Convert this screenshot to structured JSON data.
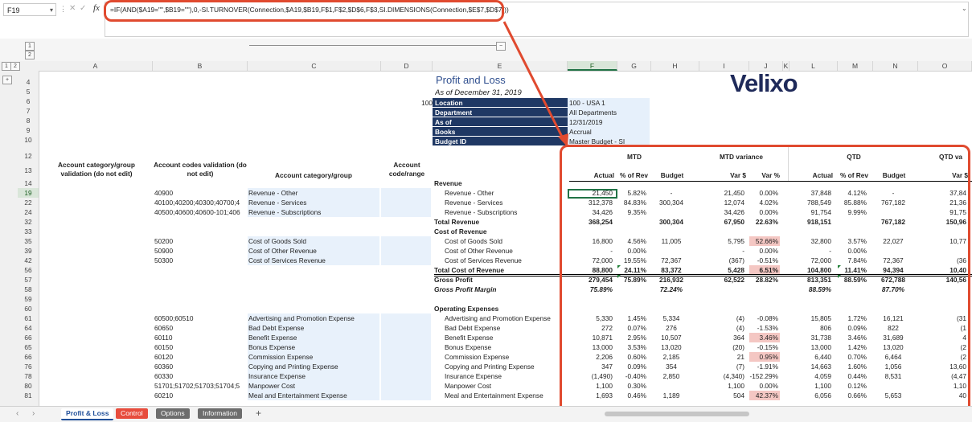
{
  "formula_bar": {
    "cell_ref": "F19",
    "formula": "=IF(AND($A19=\"\",$B19=\"\"),0,-SI.TURNOVER(Connection,$A19,$B19,F$1,F$2,$D$6,F$3,SI.DIMENSIONS(Connection,$E$7,$D$7)))",
    "dots": "⋮",
    "cancel_icon": "✕",
    "enter_icon": "✓",
    "fx_label": "fx"
  },
  "grouping": {
    "levels": [
      "1",
      "2"
    ],
    "outline": [
      "1",
      "2"
    ],
    "collapse": "−",
    "expand": "+"
  },
  "columns": [
    "A",
    "B",
    "C",
    "D",
    "E",
    "F",
    "G",
    "H",
    "I",
    "J",
    "K",
    "L",
    "M",
    "N",
    "O"
  ],
  "rows": [
    "4",
    "5",
    "6",
    "7",
    "8",
    "9",
    "10",
    "12",
    "13",
    "14",
    "19",
    "22",
    "24",
    "32",
    "33",
    "35",
    "39",
    "42",
    "56",
    "57",
    "58",
    "59",
    "60",
    "61",
    "64",
    "66",
    "65",
    "66",
    "76",
    "78",
    "80",
    "81"
  ],
  "report": {
    "title": "Profit and Loss",
    "subtitle": "As of December 31, 2019",
    "d6_value": "100",
    "params": [
      {
        "label": "Location",
        "value": "100 - USA 1"
      },
      {
        "label": "Department",
        "value": "All Departments"
      },
      {
        "label": "As of",
        "value": "12/31/2019"
      },
      {
        "label": "Books",
        "value": "Accrual"
      },
      {
        "label": "Budget ID",
        "value": "Master Budget - SI"
      }
    ],
    "logo": "Velixo"
  },
  "headers": {
    "col_a": "Account category/group validation (do not edit)",
    "col_b": "Account codes validation (do not edit)",
    "col_c": "Account category/group",
    "col_d": "Account code/range",
    "mtd": "MTD",
    "mtd_variance": "MTD variance",
    "qtd": "QTD",
    "qtd_variance": "QTD va",
    "sub": [
      "Actual",
      "% of Rev",
      "Budget",
      "Var $",
      "Var %",
      "Actual",
      "% of Rev",
      "Budget",
      "Var $"
    ]
  },
  "lines": [
    {
      "a": "",
      "b": "",
      "c": "",
      "e": "Revenue",
      "eb": true,
      "v": [
        "",
        "",
        "",
        "",
        "",
        "",
        "",
        "",
        ""
      ]
    },
    {
      "a": "",
      "b": "40900",
      "c": "Revenue - Other",
      "e": "Revenue - Other",
      "ind": true,
      "v": [
        "21,450",
        "5.82%",
        "-",
        "21,450",
        "0.00%",
        "37,848",
        "4.12%",
        "-",
        "37,84"
      ]
    },
    {
      "a": "",
      "b": "40100;40200;40300;40700;4",
      "c": "Revenue - Services",
      "e": "Revenue - Services",
      "ind": true,
      "v": [
        "312,378",
        "84.83%",
        "300,304",
        "12,074",
        "4.02%",
        "788,549",
        "85.88%",
        "767,182",
        "21,36"
      ]
    },
    {
      "a": "",
      "b": "40500;40600;40600-101;406",
      "c": "Revenue - Subscriptions",
      "e": "Revenue - Subscriptions",
      "ind": true,
      "v": [
        "34,426",
        "9.35%",
        "",
        "34,426",
        "0.00%",
        "91,754",
        "9.99%",
        "",
        "91,75"
      ]
    },
    {
      "a": "",
      "b": "",
      "c": "",
      "e": "Total Revenue",
      "eb": true,
      "vb": true,
      "v": [
        "368,254",
        "",
        "300,304",
        "67,950",
        "22.63%",
        "918,151",
        "",
        "767,182",
        "150,96"
      ]
    },
    {
      "a": "",
      "b": "",
      "c": "",
      "e": "Cost of Revenue",
      "eb": true,
      "v": [
        "",
        "",
        "",
        "",
        "",
        "",
        "",
        "",
        ""
      ]
    },
    {
      "a": "",
      "b": "50200",
      "c": "Cost of Goods Sold",
      "e": "Cost of Goods Sold",
      "ind": true,
      "v": [
        "16,800",
        "4.56%",
        "11,005",
        "5,795",
        "52.66%",
        "32,800",
        "3.57%",
        "22,027",
        "10,77"
      ],
      "neg": [
        4
      ]
    },
    {
      "a": "",
      "b": "50900",
      "c": "Cost of Other Revenue",
      "e": "Cost of Other Revenue",
      "ind": true,
      "v": [
        "-",
        "0.00%",
        "",
        "-",
        "0.00%",
        "-",
        "0.00%",
        "",
        ""
      ]
    },
    {
      "a": "",
      "b": "50300",
      "c": "Cost of Services Revenue",
      "e": "Cost of Services Revenue",
      "ind": true,
      "v": [
        "72,000",
        "19.55%",
        "72,367",
        "(367)",
        "-0.51%",
        "72,000",
        "7.84%",
        "72,367",
        "(36"
      ]
    },
    {
      "a": "",
      "b": "",
      "c": "",
      "e": "Total Cost of Revenue",
      "eb": true,
      "vb": true,
      "v": [
        "88,800",
        "24.11%",
        "83,372",
        "5,428",
        "6.51%",
        "104,800",
        "11.41%",
        "94,394",
        "10,40"
      ],
      "neg": [
        4
      ]
    },
    {
      "a": "",
      "b": "",
      "c": "",
      "e": "Gross Profit",
      "eb": true,
      "vb": true,
      "v": [
        "279,454",
        "75.89%",
        "216,932",
        "62,522",
        "28.82%",
        "813,351",
        "88.59%",
        "672,788",
        "140,56"
      ]
    },
    {
      "a": "",
      "b": "",
      "c": "",
      "e": "Gross Profit Margin",
      "eb": true,
      "ei": true,
      "vb": true,
      "vi": true,
      "v": [
        "75.89%",
        "",
        "72.24%",
        "",
        "",
        "88.59%",
        "",
        "87.70%",
        ""
      ]
    },
    {
      "a": "",
      "b": "",
      "c": "",
      "e": "",
      "v": [
        "",
        "",
        "",
        "",
        "",
        "",
        "",
        "",
        ""
      ]
    },
    {
      "a": "",
      "b": "",
      "c": "",
      "e": "Operating Expenses",
      "eb": true,
      "v": [
        "",
        "",
        "",
        "",
        "",
        "",
        "",
        "",
        ""
      ]
    },
    {
      "a": "",
      "b": "60500;60510",
      "c": "Advertising and Promotion Expense",
      "e": "Advertising and Promotion Expense",
      "ind": true,
      "v": [
        "5,330",
        "1.45%",
        "5,334",
        "(4)",
        "-0.08%",
        "15,805",
        "1.72%",
        "16,121",
        "(31"
      ]
    },
    {
      "a": "",
      "b": "60650",
      "c": "Bad Debt Expense",
      "e": "Bad Debt Expense",
      "ind": true,
      "v": [
        "272",
        "0.07%",
        "276",
        "(4)",
        "-1.53%",
        "806",
        "0.09%",
        "822",
        "(1"
      ]
    },
    {
      "a": "",
      "b": "60110",
      "c": "Benefit Expense",
      "e": "Benefit Expense",
      "ind": true,
      "v": [
        "10,871",
        "2.95%",
        "10,507",
        "364",
        "3.46%",
        "31,738",
        "3.46%",
        "31,689",
        "4"
      ],
      "neg": [
        4
      ]
    },
    {
      "a": "",
      "b": "60150",
      "c": "Bonus Expense",
      "e": "Bonus Expense",
      "ind": true,
      "v": [
        "13,000",
        "3.53%",
        "13,020",
        "(20)",
        "-0.15%",
        "13,000",
        "1.42%",
        "13,020",
        "(2"
      ]
    },
    {
      "a": "",
      "b": "60120",
      "c": "Commission Expense",
      "e": "Commission Expense",
      "ind": true,
      "v": [
        "2,206",
        "0.60%",
        "2,185",
        "21",
        "0.95%",
        "6,440",
        "0.70%",
        "6,464",
        "(2"
      ],
      "neg": [
        4
      ]
    },
    {
      "a": "",
      "b": "60360",
      "c": "Copying and Printing Expense",
      "e": "Copying and Printing Expense",
      "ind": true,
      "v": [
        "347",
        "0.09%",
        "354",
        "(7)",
        "-1.91%",
        "14,663",
        "1.60%",
        "1,056",
        "13,60"
      ]
    },
    {
      "a": "",
      "b": "60330",
      "c": "Insurance Expense",
      "e": "Insurance Expense",
      "ind": true,
      "v": [
        "(1,490)",
        "-0.40%",
        "2,850",
        "(4,340)",
        "-152.29%",
        "4,059",
        "0.44%",
        "8,531",
        "(4,47"
      ]
    },
    {
      "a": "",
      "b": "51701;51702;51703;51704;5",
      "c": "Manpower Cost",
      "e": "Manpower Cost",
      "ind": true,
      "v": [
        "1,100",
        "0.30%",
        "",
        "1,100",
        "0.00%",
        "1,100",
        "0.12%",
        "",
        "1,10"
      ]
    },
    {
      "a": "",
      "b": "60210",
      "c": "Meal and Entertainment Expense",
      "e": "Meal and Entertainment Expense",
      "ind": true,
      "v": [
        "1,693",
        "0.46%",
        "1,189",
        "504",
        "42.37%",
        "6,056",
        "0.66%",
        "5,653",
        "40"
      ],
      "neg": [
        4
      ]
    }
  ],
  "tabs": {
    "nav_prev": "‹",
    "nav_next": "›",
    "items": [
      {
        "label": "Profit & Loss",
        "color": "#ffffff",
        "active": true
      },
      {
        "label": "Control",
        "color": "#e74c3c"
      },
      {
        "label": "Options",
        "color": "#6d6d6d"
      },
      {
        "label": "Information",
        "color": "#6d6d6d"
      }
    ],
    "add": "+"
  },
  "colors": {
    "accent": "#e04a2f",
    "param_block": "#1f3864",
    "logo": "#1f2a5a",
    "negative_fill": "#f4c7c3"
  }
}
